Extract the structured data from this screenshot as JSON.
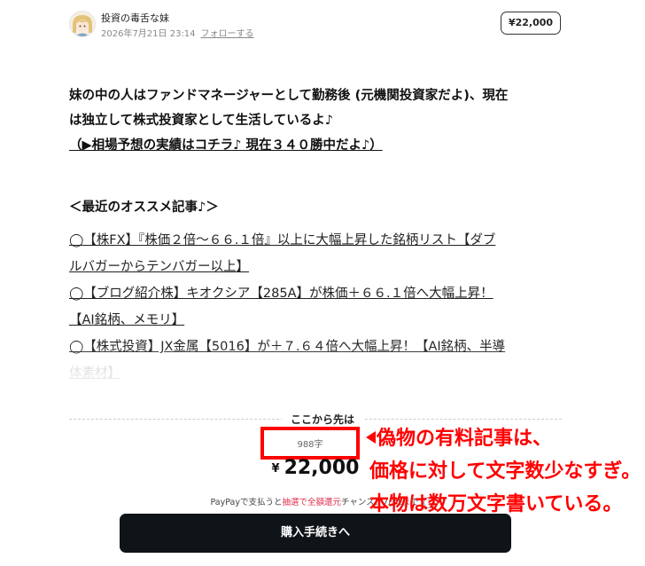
{
  "author": {
    "name": "投資の毒舌な妹",
    "date": "2026年7月21日 23:14",
    "follow_label": "フォローする"
  },
  "price_badge": "¥22,000",
  "intro": {
    "line1": "妹の中の人はファンドマネージャーとして勤務後 (元機関投資家だよ)、現在",
    "line2": "は独立して株式投資家として生活しているよ♪",
    "link": "（▶相場予想の実績はコチラ♪ 現在３４０勝中だよ♪）"
  },
  "recent_heading": "＜最近のオススメ記事♪＞",
  "articles": [
    {
      "line1": "◯【株FX】『株価２倍～６６.１倍』以上に大幅上昇した銘柄リスト【ダブ",
      "line2": "ルバガーからテンバガー以上】"
    },
    {
      "line1": "◯【ブログ紹介株】キオクシア【285A】が株価＋６６.１倍へ大幅上昇！",
      "line2": "【AI銘柄、メモリ】"
    },
    {
      "line1": "◯【株式投資】JX金属【5016】が＋７.６４倍へ大幅上昇！【AI銘柄、半導",
      "line2": "体素材】"
    }
  ],
  "paywall": {
    "from_here": "ここから先は",
    "char_count": "988字",
    "yen_symbol": "¥",
    "price": "22,000",
    "paypay_pre": "PayPayで支払うと",
    "paypay_highlight": "抽選で全額還元",
    "paypay_post": "チャンス！7/31まで",
    "info_icon": "?",
    "buy_label": "購入手続きへ"
  },
  "annotation": {
    "line1": "偽物の有料記事は、",
    "line2": "価格に対して文字数少なすぎ。",
    "line3": "本物は数万文字書いている。"
  },
  "colors": {
    "annotation": "#ff0000",
    "button": "#0f1419",
    "paypay_highlight": "#e0304f"
  }
}
